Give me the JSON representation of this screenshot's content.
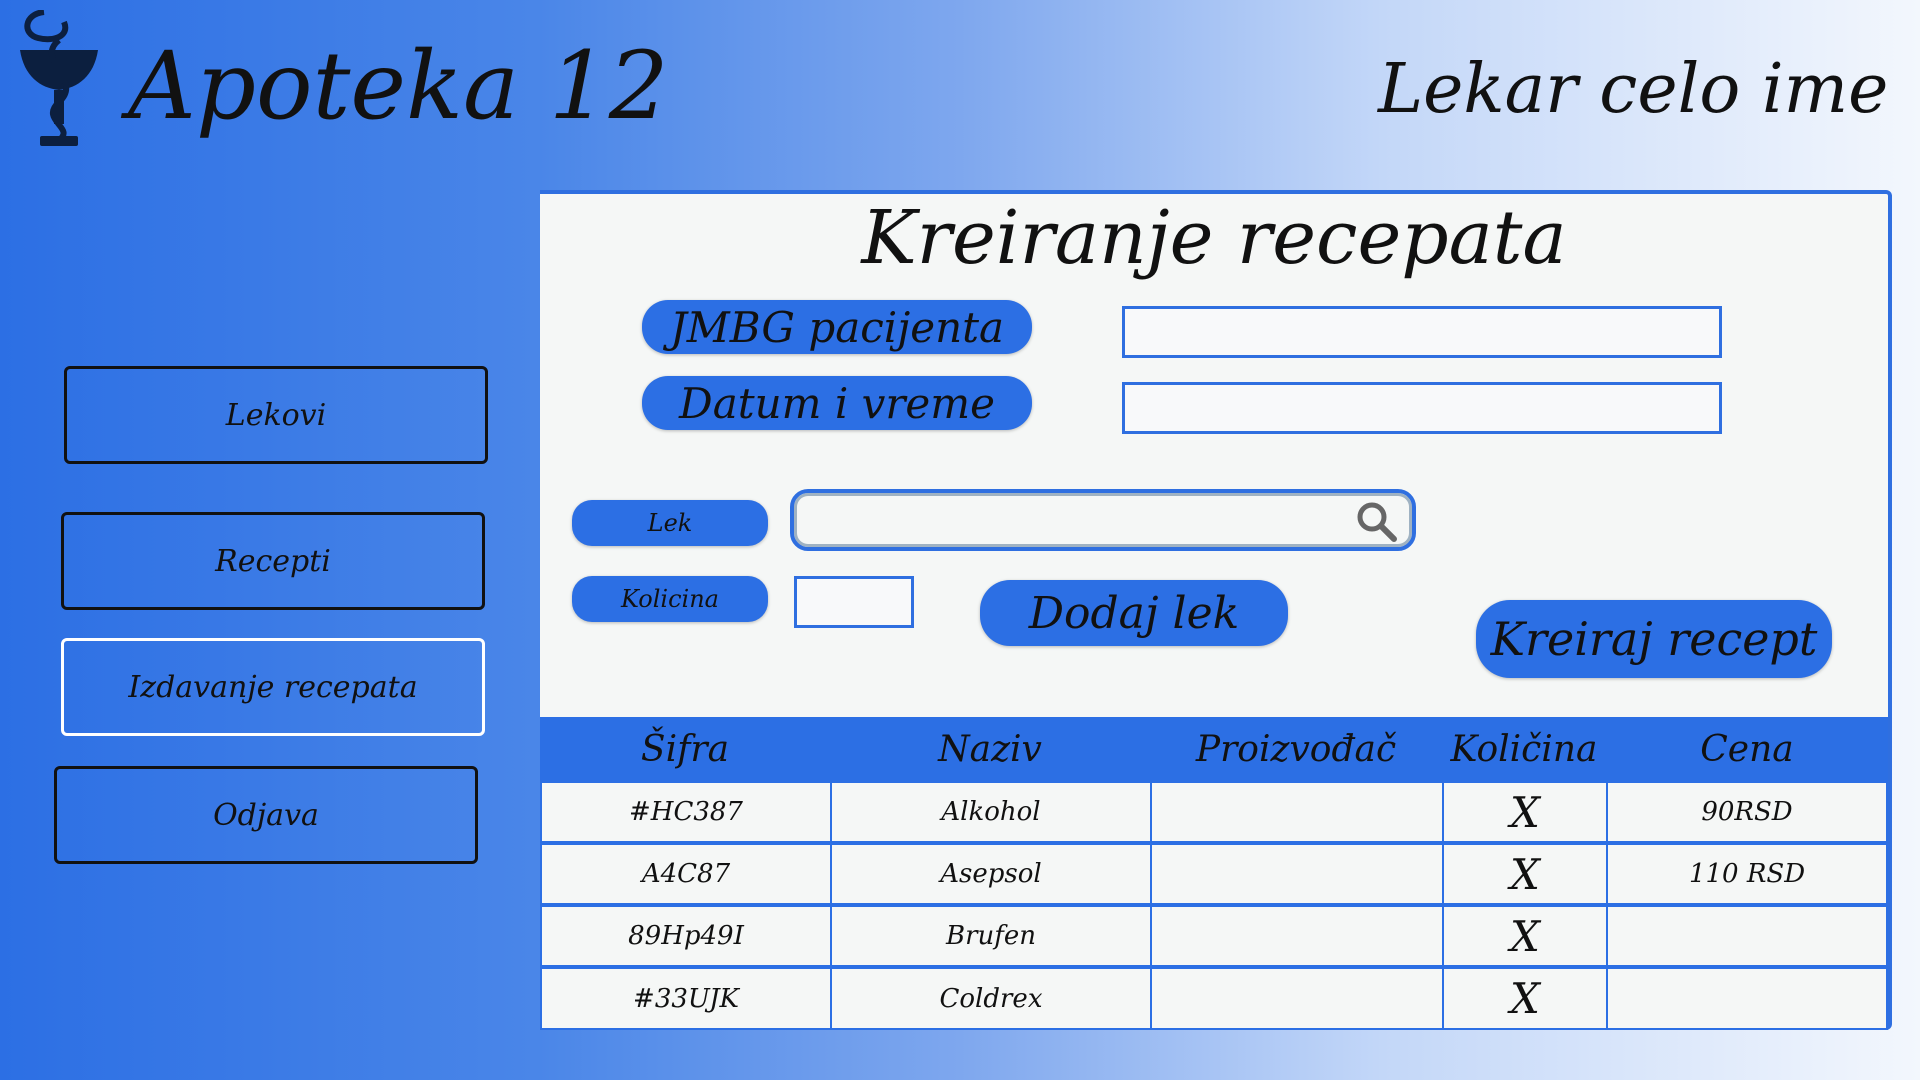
{
  "header": {
    "app_title": "Apoteka 12",
    "user_name": "Lekar celo ime"
  },
  "icons": {
    "logo": "pharmacy-bowl-of-hygieia",
    "search": "magnifier"
  },
  "colors": {
    "accent": "#2c6fe4",
    "panel_bg": "#f5f7f6"
  },
  "sidebar": {
    "items": [
      {
        "label": "Lekovi"
      },
      {
        "label": "Recepti"
      },
      {
        "label": "Izdavanje recepata"
      },
      {
        "label": "Odjava"
      }
    ]
  },
  "main": {
    "title": "Kreiranje recepata",
    "jmbg_label": "JMBG pacijenta",
    "datetime_label": "Datum i vreme",
    "jmbg_value": "",
    "datetime_value": "",
    "lek_label": "Lek",
    "search_value": "",
    "kolicina_label": "Kolicina",
    "kolicina_value": "",
    "add_button": "Dodaj lek",
    "create_button": "Kreiraj recept"
  },
  "table": {
    "headers": [
      "Šifra",
      "Naziv",
      "Proizvođač",
      "Količina",
      "Cena"
    ],
    "rows": [
      [
        "#HC387",
        "Alkohol",
        "",
        "X",
        "90RSD"
      ],
      [
        "A4C87",
        "Asepsol",
        "",
        "X",
        "110 RSD"
      ],
      [
        "89Hp49I",
        "Brufen",
        "",
        "X",
        ""
      ],
      [
        "#33UJK",
        "Coldrex",
        "",
        "X",
        ""
      ]
    ]
  }
}
